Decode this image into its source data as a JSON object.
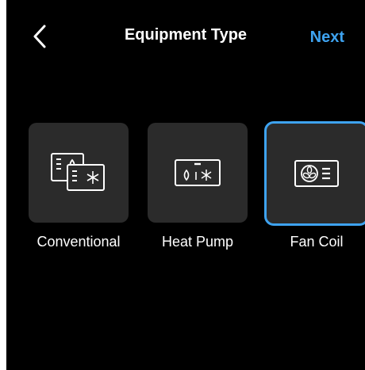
{
  "header": {
    "back_icon": "chevron-left-icon",
    "title": "Equipment Type",
    "next_label": "Next"
  },
  "colors": {
    "background": "#000000",
    "tile": "#2b2b2b",
    "accent": "#3ea3f0",
    "text": "#ffffff"
  },
  "equipment": [
    {
      "label": "Conventional",
      "icon": "conventional-furnace-ac-icon",
      "selected": false
    },
    {
      "label": "Heat Pump",
      "icon": "heat-pump-icon",
      "selected": false
    },
    {
      "label": "Fan Coil",
      "icon": "fan-coil-icon",
      "selected": true
    }
  ]
}
